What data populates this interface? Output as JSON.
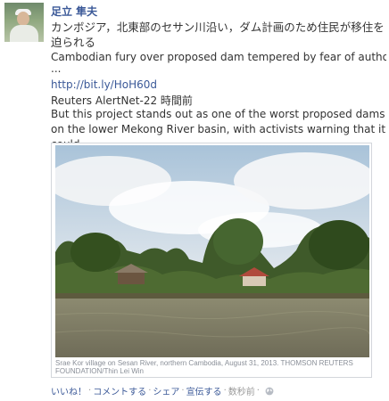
{
  "post": {
    "author": "足立 隼夫",
    "message": "カンボジア，北東部のセサン川沿い，ダム計画のため住民が移住を迫られる"
  },
  "shared": {
    "title": "Cambodian fury over proposed dam tempered by fear of authorities",
    "ellipsis": "...",
    "link": "http://bit.ly/HoH60d",
    "source": "Reuters AlertNet-22 時間前",
    "summary": "But this project stands out as one of the worst proposed dams on the lower Mekong River basin, with activists warning that it could ..."
  },
  "photo": {
    "caption": "Srae Kor village on Sesan River, northern Cambodia, August 31, 2013. THOMSON REUTERS FOUNDATION/Thin Lei Win"
  },
  "actions": {
    "like": "いいね！",
    "comment": "コメントする",
    "share": "シェア",
    "promote": "宣伝する",
    "time": "数秒前"
  },
  "icons": {
    "avatar": "avatar",
    "privacy": "globe-icon"
  },
  "colors": {
    "link": "#3b5998"
  }
}
